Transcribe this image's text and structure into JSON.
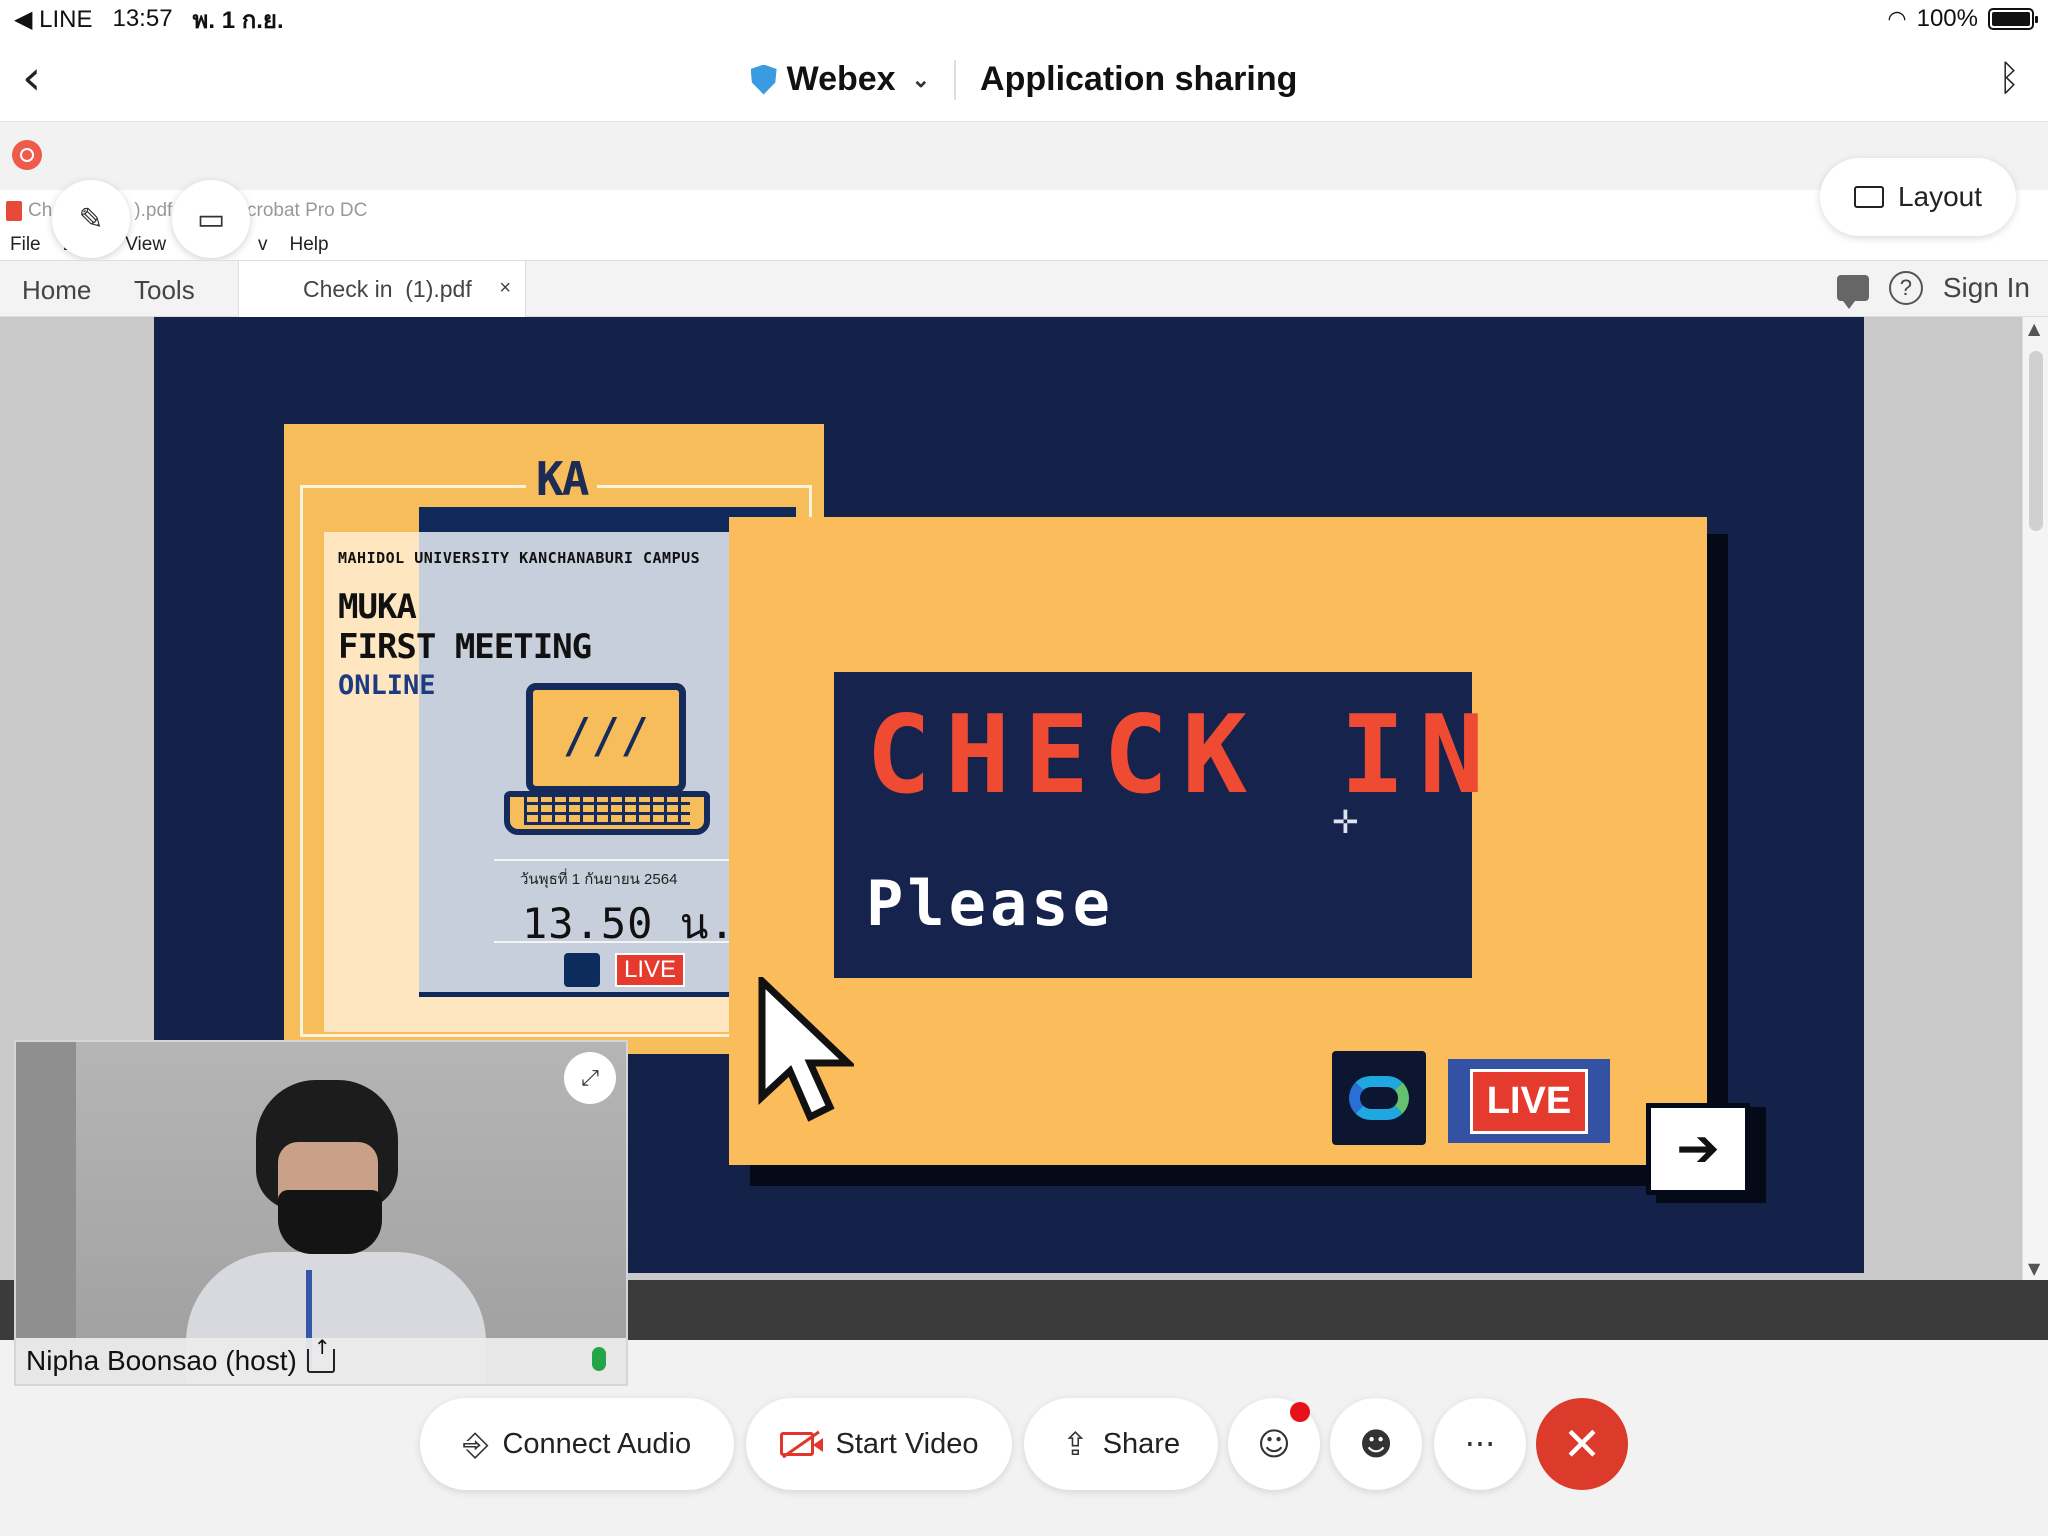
{
  "status_bar": {
    "back_app": "◀ LINE",
    "time": "13:57",
    "date": "พ. 1 ก.ย.",
    "battery": "100%"
  },
  "header": {
    "app_name": "Webex",
    "title": "Application sharing"
  },
  "acrobat": {
    "title_left": "Ch",
    "title_mid": ").pdf",
    "title_app": "Acrobat Pro DC",
    "menu": [
      "File",
      "L",
      "View",
      "W",
      "v",
      "Help"
    ],
    "layout_label": "Layout"
  },
  "tabbar": {
    "home": "Home",
    "tools": "Tools",
    "doc_tab": "Check in  (1).pdf",
    "close": "×",
    "sign_in": "Sign In",
    "help": "?"
  },
  "slide": {
    "ka_logo": "KA",
    "university": "MAHIDOL UNIVERSITY KANCHANABURI CAMPUS",
    "title_line1": "MUKA",
    "title_line2": "FIRST MEETING",
    "online": "ONLINE",
    "date_thai": "วันพุธที่ 1 กันยายน 2564",
    "time": "13.50 น.",
    "live_small": "LIVE",
    "check_in": "CHECK IN",
    "please": "Please",
    "live_big": "LIVE",
    "arrow": "➔"
  },
  "self_view": {
    "name": "Nipha Boonsao (host)"
  },
  "controls": {
    "connect_audio": "Connect Audio",
    "start_video": "Start Video",
    "share": "Share",
    "more": "···"
  },
  "colors": {
    "slide_navy": "#142148",
    "slide_orange": "#fbbc5c",
    "check_in_red": "#ef4a32",
    "end_call_red": "#dc3a2a"
  }
}
